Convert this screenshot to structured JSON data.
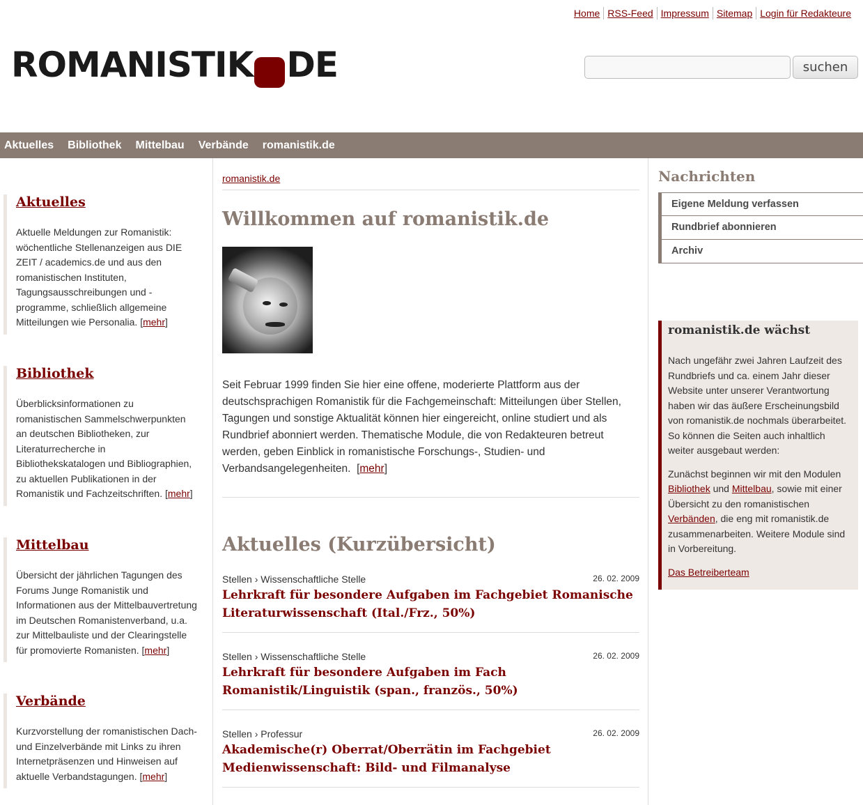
{
  "toplinks": [
    "Home",
    "RSS-Feed",
    "Impressum",
    "Sitemap",
    "Login für Redakteure"
  ],
  "logo": {
    "left": "ROMANISTIK",
    "right": "DE"
  },
  "search": {
    "button": "suchen",
    "value": ""
  },
  "nav": [
    "Aktuelles",
    "Bibliothek",
    "Mittelbau",
    "Verbände",
    "romanistik.de"
  ],
  "left": [
    {
      "title": "Aktuelles",
      "text": "Aktuelle Meldungen zur Romanistik: wöchentliche Stellenanzeigen aus DIE ZEIT / academics.de und aus den romanistischen Instituten, Tagungsausschreibungen und -programme, schließlich allgemeine Mitteilungen wie Personalia.",
      "more": "mehr"
    },
    {
      "title": "Bibliothek",
      "text": "Überblicksinformationen zu romanistischen Sammelschwerpunkten an deutschen Bibliotheken, zur Literaturrecherche in Bibliothekskatalogen und Bibliographien, zu aktuellen Publikationen in der Romanistik und Fachzeitschriften.",
      "more": "mehr"
    },
    {
      "title": "Mittelbau",
      "text": "Übersicht der jährlichen Tagungen des Forums Junge Romanistik und Informationen aus der Mittelbauvertretung im Deutschen Romanistenverband, u.a. zur Mittelbauliste und der Clearingstelle für promovierte Romanisten.",
      "more": "mehr"
    },
    {
      "title": "Verbände",
      "text": "Kurzvorstellung der romanistischen Dach- und Einzelverbände mit Links zu ihren Internetpräsenzen und Hinweisen auf aktuelle Verbandstagungen.",
      "more": "mehr"
    }
  ],
  "main": {
    "breadcrumb": "romanistik.de",
    "title": "Willkommen auf romanistik.de",
    "intro": "Seit Februar 1999 finden Sie hier eine offene, moderierte Plattform aus der deutschsprachigen Romanistik für die Fachgemeinschaft: Mitteilungen über Stellen, Tagungen und sonstige Aktualität können hier eingereicht, online studiert und als Rundbrief abonniert werden. Thematische Module, die von Redakteuren betreut werden, geben Einblick in romanistische Forschungs-, Studien- und Verbandsangelegenheiten.",
    "more": "mehr",
    "section_title": "Aktuelles (Kurzübersicht)",
    "news": [
      {
        "cat": "Stellen",
        "sub": "Wissenschaftliche Stelle",
        "date": "26. 02. 2009",
        "title": "Lehrkraft für besondere Aufgaben im Fachgebiet Romanische Literaturwissenschaft (Ital./Frz., 50%)"
      },
      {
        "cat": "Stellen",
        "sub": "Wissenschaftliche Stelle",
        "date": "26. 02. 2009",
        "title": "Lehrkraft für besondere Aufgaben im Fach Romanistik/Linguistik (span., französ., 50%)"
      },
      {
        "cat": "Stellen",
        "sub": "Professur",
        "date": "26. 02. 2009",
        "title": "Akademische(r) Oberrat/Oberrätin im Fachgebiet Medienwissenschaft: Bild- und Filmanalyse"
      }
    ]
  },
  "right": {
    "heading": "Nachrichten",
    "menu": [
      "Eigene Meldung verfassen",
      "Rundbrief abonnieren",
      "Archiv"
    ],
    "box_title": "romanistik.de wächst",
    "box_p1": "Nach ungefähr zwei Jahren Laufzeit des Rundbriefs und ca. einem Jahr dieser Website unter unserer Verantwortung haben wir das äußere Erscheinungsbild von romanistik.de nochmals überarbeitet. So können die Seiten auch inhaltlich weiter ausgebaut werden:",
    "box_p2_a": "Zunächst beginnen wir mit den Modulen ",
    "box_link1": "Bibliothek",
    "box_p2_b": " und ",
    "box_link2": "Mittelbau",
    "box_p2_c": ", sowie mit einer Übersicht zu den romanistischen ",
    "box_link3": "Verbänden",
    "box_p2_d": ", die eng mit romanistik.de zusammenarbeiten. Weitere Module sind in Vorbereitung.",
    "box_sign": "Das Betreiberteam"
  }
}
